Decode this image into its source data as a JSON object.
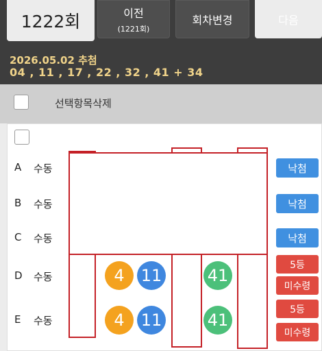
{
  "header": {
    "round": "1222회",
    "prev_label": "이전",
    "prev_sub": "(1221회)",
    "change_label": "회차변경",
    "next_label": "다음",
    "draw_date": "2026.05.02 추첨",
    "draw_numbers": "04 , 11 , 17 , 22 , 32 , 41  +  34"
  },
  "toolbar": {
    "delete_label": "선택항목삭제"
  },
  "rows": [
    {
      "letter": "A",
      "mode": "수동",
      "result": "낙첨"
    },
    {
      "letter": "B",
      "mode": "수동",
      "result": "낙첨"
    },
    {
      "letter": "C",
      "mode": "수동",
      "result": "낙첨"
    },
    {
      "letter": "D",
      "mode": "수동",
      "rank": "5등",
      "claim": "미수령",
      "balls": [
        "4",
        "11",
        "41"
      ]
    },
    {
      "letter": "E",
      "mode": "수동",
      "rank": "5등",
      "claim": "미수령",
      "balls": [
        "4",
        "11",
        "41"
      ]
    }
  ],
  "colors": {
    "win_blue": "#4090e0",
    "rank_red": "#e04a40",
    "ball_orange": "#f4a21f",
    "ball_blue": "#3f87df",
    "ball_green": "#4cc07a",
    "redaction_border": "#c42026"
  }
}
